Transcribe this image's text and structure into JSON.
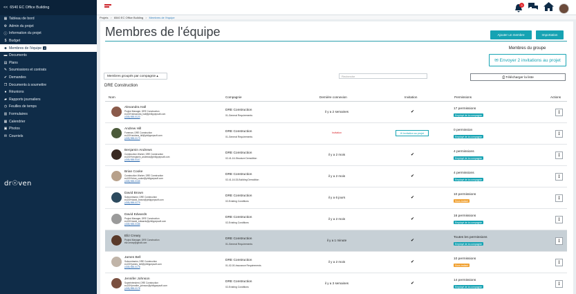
{
  "sidebar": {
    "project_label": "6540 EC Office Building",
    "items": [
      {
        "icon": "dashboard-icon",
        "glyph": "▦",
        "label": "Tableau de bord"
      },
      {
        "icon": "gear-icon",
        "glyph": "⚙",
        "label": "Admin du projet"
      },
      {
        "icon": "info-icon",
        "glyph": "ⓘ",
        "label": "Information du projet"
      },
      {
        "icon": "dollar-icon",
        "glyph": "$",
        "label": "Budget"
      },
      {
        "icon": "users-icon",
        "glyph": "☻",
        "label": "Membres de l'équipe",
        "badge": "2",
        "active": true
      },
      {
        "icon": "folder-icon",
        "glyph": "▬",
        "label": "Documents"
      },
      {
        "icon": "map-icon",
        "glyph": "▤",
        "label": "Plans"
      },
      {
        "icon": "gavel-icon",
        "glyph": "✎",
        "label": "Soumissions et contrats"
      },
      {
        "icon": "check-icon",
        "glyph": "✔",
        "label": "Demandes"
      },
      {
        "icon": "copy-icon",
        "glyph": "❐",
        "label": "Documents à soumettre"
      },
      {
        "icon": "pin-icon",
        "glyph": "●",
        "label": "Réunions"
      },
      {
        "icon": "truck-icon",
        "glyph": "▰",
        "label": "Rapports journaliers"
      },
      {
        "icon": "clock-icon",
        "glyph": "◷",
        "label": "Feuilles de temps"
      },
      {
        "icon": "form-icon",
        "glyph": "▥",
        "label": "Formulaires"
      },
      {
        "icon": "calendar-icon",
        "glyph": "▦",
        "label": "Calendrier"
      },
      {
        "icon": "image-icon",
        "glyph": "▣",
        "label": "Photos"
      },
      {
        "icon": "mail-icon",
        "glyph": "✉",
        "label": "Courriels"
      }
    ],
    "logo_text": "dr☉ven"
  },
  "topbar": {
    "notification_count": "3"
  },
  "breadcrumb": [
    "Projets",
    "6540 EC Office Building",
    "Membres de l'équipe"
  ],
  "page": {
    "title": "Membres de l'équipe",
    "add_member_label": "Ajouter un membre",
    "import_label": "Importation",
    "group_title": "Membres du groupe",
    "send_invites_label": "✉ Envoyer 2 invitations au projet",
    "group_by_label": "Membres groupés par compagnie ▴",
    "search_placeholder": "Recherche",
    "download_label": "⎙ Télécharger la liste",
    "company_heading": "DRE Construction"
  },
  "table": {
    "headers": {
      "name": "Nom",
      "company": "Compagnie",
      "last_login": "Dernière connexion",
      "invitation": "Invitation",
      "permissions": "Permissions",
      "actions": "Actions"
    },
    "rows": [
      {
        "name": "Alexandra Hall",
        "title": "Project Manager, DRE Construction",
        "email": "ec100+alexandra_hall@philippepsoft.com",
        "phone": "(438) 555-0120",
        "company": "DRE Construction",
        "division": "01-General Requirements",
        "last_login": "il y a 2 semaines",
        "invited": true,
        "permissions": "17 permissions",
        "tag": "Employé de la compagnie",
        "tag_color": "#16a3b3",
        "photo_color": "#8a5a4a",
        "highlight": false
      },
      {
        "name": "Andrew Hill",
        "title": "Foreman, DRE Construction",
        "email": "ec100+andrew_hill@philippepsoft.com",
        "phone": "(438) 555-0173",
        "company": "DRE Construction",
        "division": "01-General Requirements",
        "last_login": "Invitation",
        "last_login_red": true,
        "invited": false,
        "invite_label": "✉ Invitation au projet",
        "permissions": "0 permission",
        "tag": "Employé de la compagnie",
        "tag_color": "#16a3b3",
        "photo_color": "#4b5a3a",
        "highlight": false
      },
      {
        "name": "Benjamin Andrews",
        "title": "Construction Worker, DRE Construction",
        "email": "ec100+benjamin_andrews@philippepsoft.com",
        "phone": "(438) 555-0110",
        "company": "DRE Construction",
        "division": "02-41-16-Structure Demolition",
        "last_login": "il y a 2 mois",
        "invited": true,
        "permissions": "4 permissions",
        "tag": "Employé de la compagnie",
        "tag_color": "#16a3b3",
        "photo_color": "#3a2a22",
        "highlight": false
      },
      {
        "name": "Brian Cooke",
        "title": "Construction Worker, DRE Construction",
        "email": "ec100+brian_cooke@philippepsoft.com",
        "phone": "(438) 555-0165",
        "company": "DRE Construction",
        "division": "02-41-16.33-Building Demolition",
        "last_login": "il y a 2 mois",
        "invited": true,
        "permissions": "4 permissions",
        "tag": "Employé de la compagnie",
        "tag_color": "#16a3b3",
        "photo_color": "#b7a08a",
        "highlight": false
      },
      {
        "name": "David Brown",
        "title": "Subcontractor, DRE Construction",
        "email": "ec100+david_brown@philippepsoft.com",
        "phone": "(438) 555-0179",
        "company": "DRE Construction",
        "division": "02-Existing Conditions",
        "last_login": "il y a 6 jours",
        "invited": true,
        "permissions": "10 permissions",
        "tag": "Sous-traitant",
        "tag_color": "#f0a030",
        "photo_color": "#2c4a5e",
        "highlight": false
      },
      {
        "name": "David Edwards",
        "title": "Project Manager, DRE Construction",
        "email": "ec100+david_edwards@philippepsoft.com",
        "phone": "(438) 555-0185",
        "company": "DRE Construction",
        "division": "02-Existing Conditions",
        "last_login": "il y a 2 mois",
        "invited": true,
        "permissions": "16 permissions",
        "tag": "Employé de la compagnie",
        "tag_color": "#16a3b3",
        "photo_color": "#9a9a9a",
        "highlight": false
      },
      {
        "name": "Eliz Creary",
        "title": "Project Manager, DRE Construction",
        "email": "eliz.creary@gmail.com",
        "phone": "",
        "company": "DRE Construction",
        "division": "01-General Requirements",
        "last_login": "il y a 1 minute",
        "invited": true,
        "permissions": "Toutes les permissions",
        "tag": "Employé de la compagnie",
        "tag_color": "#16a3b3",
        "photo_color": "#5a3a2a",
        "highlight": true
      },
      {
        "name": "James Bell",
        "title": "Subcontractor, DRE Construction",
        "email": "ec100+james_bell@philippepsoft.com",
        "phone": "(438) 555-0178",
        "company": "DRE Construction",
        "division": "01-02-00-Insurance Requirements",
        "last_login": "il y a 2 mois",
        "invited": true,
        "permissions": "10 permissions",
        "tag": "Sous-traitant",
        "tag_color": "#f0a030",
        "photo_color": "#c0b4a8",
        "highlight": false
      },
      {
        "name": "Jennifer Johnson",
        "title": "Superintendent, DRE Construction",
        "email": "ec100+jennifer_johnson@philippepsoft.com",
        "phone": "(438) 555-0176",
        "company": "DRE Construction",
        "division": "02-Existing Conditions",
        "last_login": "il y a 3 semaines",
        "invited": true,
        "permissions": "14 permissions",
        "tag": "Employé de la compagnie",
        "tag_color": "#16a3b3",
        "photo_color": "#7a5040",
        "highlight": false
      }
    ]
  }
}
